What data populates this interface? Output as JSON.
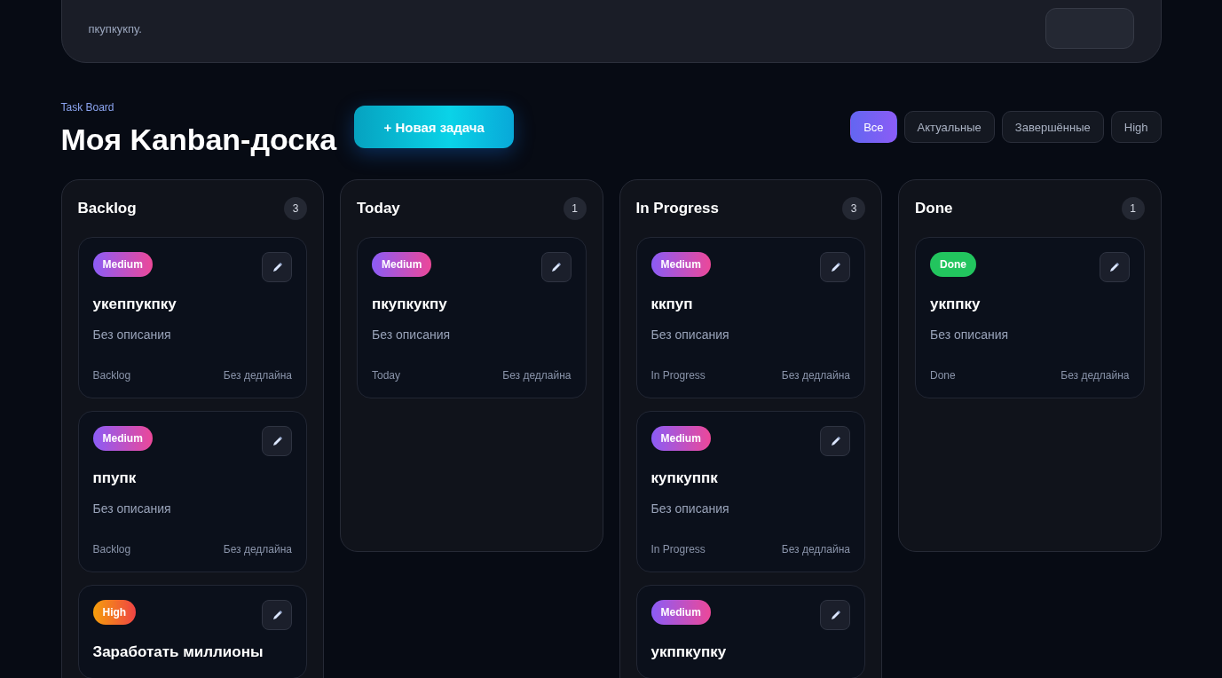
{
  "priority_card": {
    "text": "пкупкукпу."
  },
  "board": {
    "eyebrow": "Task Board",
    "title": "Моя Kanban-доска",
    "new_button": "+ Новая задача"
  },
  "filters": [
    {
      "label": "Все",
      "selected": true
    },
    {
      "label": "Актуальные",
      "selected": false
    },
    {
      "label": "Завершённые",
      "selected": false
    },
    {
      "label": "High",
      "selected": false
    }
  ],
  "columns": [
    {
      "title": "Backlog",
      "count": "3",
      "cards": [
        {
          "badge": {
            "label": "Medium",
            "kind": "medium"
          },
          "title": "укеппукпку",
          "description": "Без описания",
          "status": "Backlog",
          "deadline": "Без дедлайна"
        },
        {
          "badge": {
            "label": "Medium",
            "kind": "medium"
          },
          "title": "ппупк",
          "description": "Без описания",
          "status": "Backlog",
          "deadline": "Без дедлайна"
        },
        {
          "badge": {
            "label": "High",
            "kind": "high"
          },
          "title": "Заработать миллионы"
        }
      ]
    },
    {
      "title": "Today",
      "count": "1",
      "cards": [
        {
          "badge": {
            "label": "Medium",
            "kind": "medium"
          },
          "title": "пкупкукпу",
          "description": "Без описания",
          "status": "Today",
          "deadline": "Без дедлайна"
        }
      ]
    },
    {
      "title": "In Progress",
      "count": "3",
      "cards": [
        {
          "badge": {
            "label": "Medium",
            "kind": "medium"
          },
          "title": "ккпуп",
          "description": "Без описания",
          "status": "In Progress",
          "deadline": "Без дедлайна"
        },
        {
          "badge": {
            "label": "Medium",
            "kind": "medium"
          },
          "title": "купкуппк",
          "description": "Без описания",
          "status": "In Progress",
          "deadline": "Без дедлайна"
        },
        {
          "badge": {
            "label": "Medium",
            "kind": "medium"
          },
          "title": "укппкупку"
        }
      ]
    },
    {
      "title": "Done",
      "count": "1",
      "cards": [
        {
          "badge": {
            "label": "Done",
            "kind": "done"
          },
          "title": "укппку",
          "description": "Без описания",
          "status": "Done",
          "deadline": "Без дедлайна"
        }
      ]
    }
  ]
}
